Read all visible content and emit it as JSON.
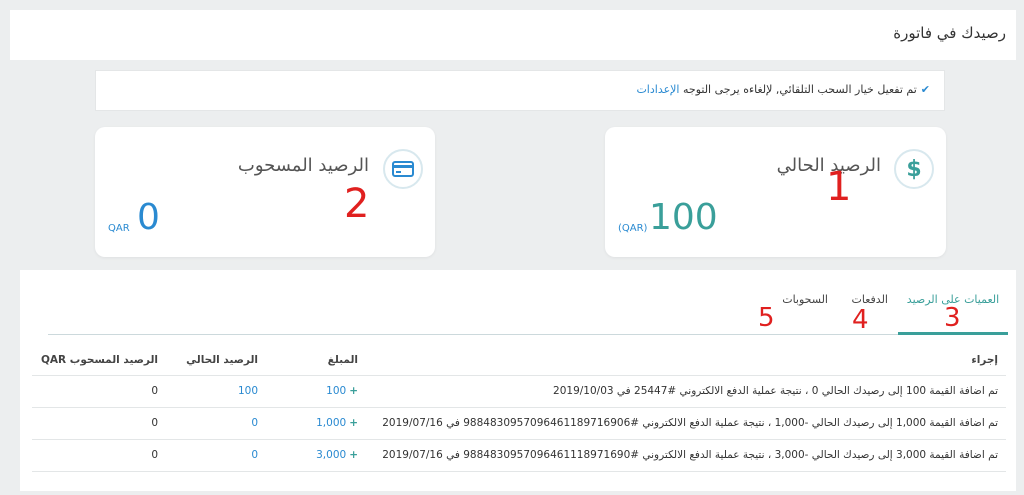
{
  "header": {
    "title": "رصيدك في فاتورة"
  },
  "notice": {
    "text": "تم تفعيل خيار السحب التلقائي, لإلغاءه يرجى التوجه ",
    "link": "الإعدادات",
    "icon": "check-icon"
  },
  "cards": {
    "current": {
      "title": "الرصيد الحالي",
      "amount": "100",
      "currency": "(QAR)",
      "icon": "dollar-icon"
    },
    "withdrawn": {
      "title": "الرصيد المسحوب",
      "amount": "0",
      "currency": "QAR",
      "icon": "credit-card-icon"
    }
  },
  "markers": [
    "1",
    "2",
    "3",
    "4",
    "5"
  ],
  "tabs": [
    {
      "label": "العميات على الرصيد",
      "active": true
    },
    {
      "label": "الدفعات",
      "active": false
    },
    {
      "label": "السحوبات",
      "active": false
    }
  ],
  "table": {
    "headers": [
      "إجراء",
      "المبلغ",
      "الرصيد الحالي",
      "الرصيد المسحوب QAR"
    ],
    "rows": [
      {
        "action": "تم اضافة القيمة 100 إلى رصيدك الحالي 0 ، نتيجة عملية الدفع الالكتروني #25447 في 2019/10/03",
        "amount": "100",
        "current": "100",
        "withdrawn": "0"
      },
      {
        "action": "تم اضافة القيمة 1,000 إلى رصيدك الحالي -1,000 ، نتيجة عملية الدفع الالكتروني #9884830957096461189716906 في 2019/07/16",
        "amount": "1,000",
        "current": "0",
        "withdrawn": "0"
      },
      {
        "action": "تم اضافة القيمة 3,000 إلى رصيدك الحالي -3,000 ، نتيجة عملية الدفع الالكتروني #9884830957096461118971690 في 2019/07/16",
        "amount": "3,000",
        "current": "0",
        "withdrawn": "0"
      }
    ]
  },
  "colors": {
    "accent": "#3a9f9a",
    "link": "#2a8ad1",
    "marker": "#e0201f"
  }
}
